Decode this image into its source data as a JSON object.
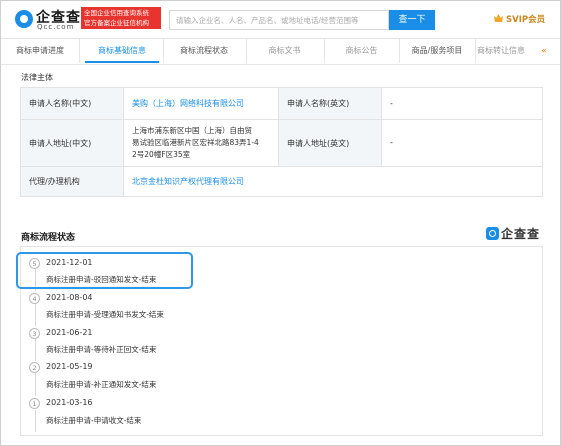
{
  "header": {
    "logo_text": "企查查",
    "logo_sub": "Qcc.com",
    "badge_line1": "全国企业信用查询系统",
    "badge_line2": "官方备案企业征信机构",
    "search_placeholder": "请输入企业名、人名、产品名、或地址电话/经营范围等",
    "search_button": "查一下",
    "svip_label": "SVIP会员"
  },
  "tabs": [
    {
      "label": "商标申请进度"
    },
    {
      "label": "商标基础信息"
    },
    {
      "label": "商标流程状态"
    },
    {
      "label": "商标文书"
    },
    {
      "label": "商标公告"
    },
    {
      "label": "商品/服务项目"
    },
    {
      "label": "商标转让信息"
    }
  ],
  "legal": {
    "section_title": "法律主体",
    "rows": [
      {
        "label1": "申请人名称(中文)",
        "value1": "美购（上海）网络科技有限公司",
        "label2": "申请人名称(英文)",
        "value2": "-"
      },
      {
        "label1": "申请人地址(中文)",
        "value1_lines": [
          "上海市浦东新区中国（上海）自由贸",
          "易试验区临港新片区宏祥北路83弄1-4",
          "2号20幢F区35室"
        ],
        "label2": "申请人地址(英文)",
        "value2": "-"
      },
      {
        "label1": "代理/办理机构",
        "value1": "北京金杜知识产权代理有限公司"
      }
    ]
  },
  "flow": {
    "title": "商标流程状态",
    "brand": "企查查",
    "items": [
      {
        "num": "5",
        "date": "2021-12-01",
        "desc": "商标注册申请-驳回通知发文-结束"
      },
      {
        "num": "4",
        "date": "2021-08-04",
        "desc": "商标注册申请-受理通知书发文-结束"
      },
      {
        "num": "3",
        "date": "2021-06-21",
        "desc": "商标注册申请-等待补正回文-结束"
      },
      {
        "num": "2",
        "date": "2021-05-19",
        "desc": "商标注册申请-补正通知发文-结束"
      },
      {
        "num": "1",
        "date": "2021-03-16",
        "desc": "商标注册申请-申请收文-结束"
      }
    ]
  },
  "colors": {
    "accent": "#1a8ee6",
    "highlight": "#2f97e8",
    "badge": "#e8342e"
  }
}
